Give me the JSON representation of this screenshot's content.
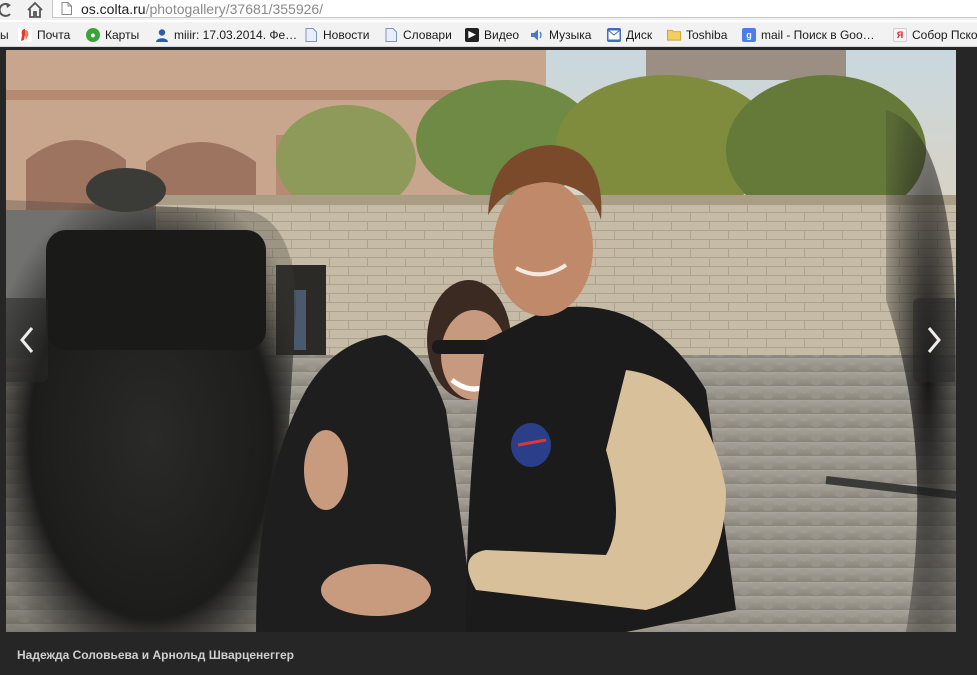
{
  "browser": {
    "url_host": "os.colta.ru",
    "url_path": "/photogallery/37681/355926/"
  },
  "bookmarks": [
    {
      "label": "ы",
      "icon": "cut-off-item-icon",
      "color": "#999999"
    },
    {
      "label": "Почта",
      "icon": "yandex-mail-icon",
      "color": "#e23b2e"
    },
    {
      "label": "Карты",
      "icon": "yandex-maps-icon",
      "color": "#3aa33a"
    },
    {
      "label": "miiir: 17.03.2014. Фе…",
      "icon": "livejournal-user-icon",
      "color": "#2d5da8"
    },
    {
      "label": "Новости",
      "icon": "page-icon",
      "color": "#8aa0c8"
    },
    {
      "label": "Словари",
      "icon": "page-icon",
      "color": "#8aa0c8"
    },
    {
      "label": "Видео",
      "icon": "video-play-icon",
      "color": "#222222"
    },
    {
      "label": "Музыка",
      "icon": "music-speaker-icon",
      "color": "#4a78c2"
    },
    {
      "label": "Диск",
      "icon": "mail-envelope-icon",
      "color": "#3f6fb5"
    },
    {
      "label": "Toshiba",
      "icon": "folder-icon",
      "color": "#e8c24a"
    },
    {
      "label": "mail - Поиск в Goo…",
      "icon": "google-icon",
      "color": "#4a7fe8"
    },
    {
      "label": "Собор Пско",
      "icon": "yandex-icon",
      "color": "#d9d9d9"
    }
  ],
  "gallery": {
    "caption": "Надежда Соловьева и Арнольд Шварценеггер",
    "prev_icon": "chevron-left-icon",
    "next_icon": "chevron-right-icon"
  }
}
